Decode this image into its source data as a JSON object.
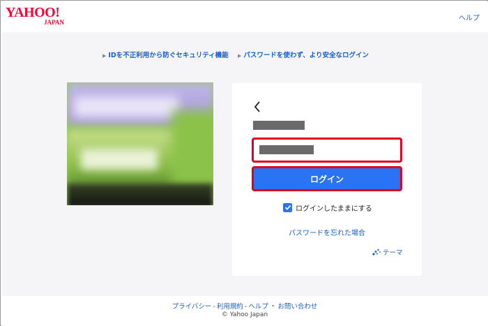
{
  "header": {
    "logo_main": "YAHOO!",
    "logo_sub": "JAPAN",
    "help_label": "ヘルプ"
  },
  "promo": {
    "link1": "IDを不正利用から防ぐセキュリティ機能",
    "link2": "パスワードを使わず、より安全なログイン"
  },
  "login": {
    "back_icon": "chevron-left-icon",
    "login_button_label": "ログイン",
    "keep_login_label": "ログインしたままにする",
    "keep_login_checked": true,
    "forgot_password_label": "パスワードを忘れた場合",
    "theme_label": "テーマ"
  },
  "footer": {
    "privacy": "プライバシー",
    "terms": "利用規約",
    "help": "ヘルプ",
    "contact": "お問い合わせ",
    "copyright": "© Yahoo Japan"
  },
  "colors": {
    "brand_red": "#ff0033",
    "link_blue": "#1a5ec9",
    "button_blue": "#2b73f5",
    "highlight_red": "#e0001b"
  }
}
